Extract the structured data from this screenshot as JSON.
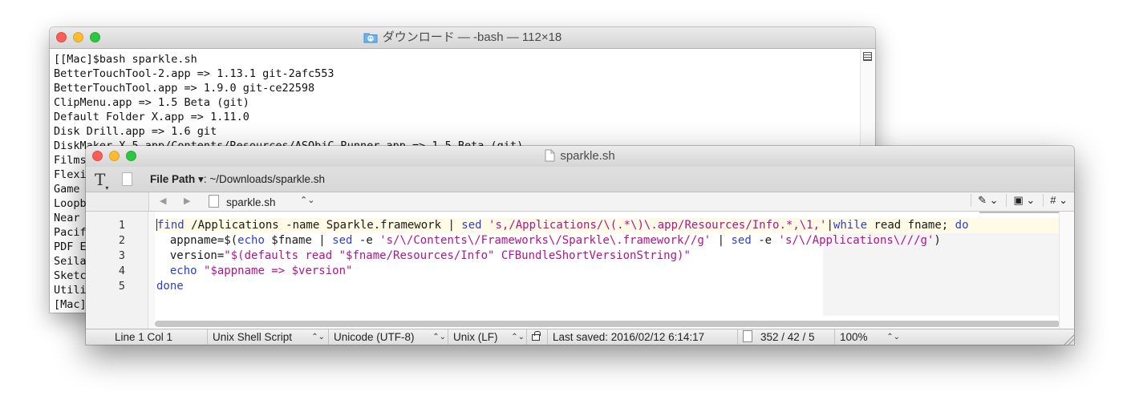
{
  "terminal": {
    "title": "ダウンロード — -bash — 112×18",
    "lines": [
      "[[Mac]$bash sparkle.sh",
      "BetterTouchTool-2.app => 1.13.1 git-2afc553",
      "BetterTouchTool.app => 1.9.0 git-ce22598",
      "ClipMenu.app => 1.5 Beta (git)",
      "Default Folder X.app => 1.11.0",
      "Disk Drill.app => 1.6 git",
      "DiskMaker X 5.app/Contents/Resources/ASObjC Runner.app => 1.5 Beta (git)",
      "Films",
      "Flexi",
      "Game ",
      "Loopb",
      "Near ",
      "Pacif",
      "PDF E",
      "Seila",
      "Sketc",
      "Utili",
      "[Mac]"
    ]
  },
  "editor": {
    "title": "sparkle.sh",
    "toolbar": {
      "text_tool": "T",
      "path_label": "File Path",
      "path_arrow": "▾",
      "path_value": ": ~/Downloads/sparkle.sh"
    },
    "nav": {
      "back": "◀",
      "forward": "▶",
      "file_name": "sparkle.sh",
      "file_menu_arrows": "⌃⌄",
      "marker_menu": "✎ ⌄",
      "window_menu": "▣ ⌄",
      "counter_menu": "# ⌄"
    },
    "line_numbers": [
      "1",
      "2",
      "3",
      "4",
      "5"
    ],
    "code_lines": [
      [
        {
          "t": "find",
          "c": "kw"
        },
        {
          "t": " /Applications -name Sparkle.framework | ",
          "c": "plain"
        },
        {
          "t": "sed",
          "c": "kw"
        },
        {
          "t": " ",
          "c": "plain"
        },
        {
          "t": "'s,/Applications/\\(.*\\)\\.app/Resources/Info.*,\\1,'",
          "c": "str"
        },
        {
          "t": "|",
          "c": "plain"
        },
        {
          "t": "while",
          "c": "kw"
        },
        {
          "t": " read fname; ",
          "c": "plain"
        },
        {
          "t": "do",
          "c": "kw"
        }
      ],
      [
        {
          "t": "  appname=$(",
          "c": "plain"
        },
        {
          "t": "echo",
          "c": "kw"
        },
        {
          "t": " $fname | ",
          "c": "plain"
        },
        {
          "t": "sed",
          "c": "kw"
        },
        {
          "t": " -e ",
          "c": "plain"
        },
        {
          "t": "'s/\\/Contents\\/Frameworks\\/Sparkle\\.framework//g'",
          "c": "str"
        },
        {
          "t": " | ",
          "c": "plain"
        },
        {
          "t": "sed",
          "c": "kw"
        },
        {
          "t": " -e ",
          "c": "plain"
        },
        {
          "t": "'s/\\/Applications\\///g'",
          "c": "str"
        },
        {
          "t": ")",
          "c": "plain"
        }
      ],
      [
        {
          "t": "  version=",
          "c": "plain"
        },
        {
          "t": "\"$(defaults read \"$fname/Resources/Info\" CFBundleShortVersionString)\"",
          "c": "str"
        }
      ],
      [
        {
          "t": "  ",
          "c": "plain"
        },
        {
          "t": "echo",
          "c": "kw"
        },
        {
          "t": " ",
          "c": "plain"
        },
        {
          "t": "\"$appname => $version\"",
          "c": "str"
        }
      ],
      [
        {
          "t": "done",
          "c": "kw"
        }
      ]
    ],
    "status": {
      "position": "Line 1 Col 1",
      "syntax": "Unix Shell Script",
      "encoding": "Unicode (UTF-8)",
      "line_endings": "Unix (LF)",
      "last_saved": "Last saved: 2016/02/12 6:14:17",
      "counts": "352 / 42 / 5",
      "zoom": "100%",
      "updown": "⌃⌄"
    }
  },
  "colors": {
    "keyword": "#2a3fd0",
    "string": "#b0148e",
    "current_line": "#fffbe6"
  }
}
